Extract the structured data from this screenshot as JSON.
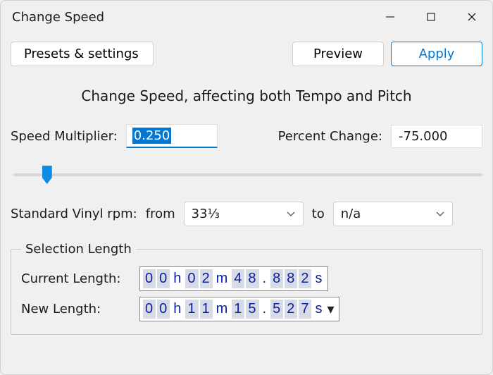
{
  "window": {
    "title": "Change Speed"
  },
  "buttons": {
    "presets": "Presets & settings",
    "preview": "Preview",
    "apply": "Apply"
  },
  "heading": "Change Speed, affecting both Tempo and Pitch",
  "speed": {
    "multiplier_label": "Speed Multiplier:",
    "multiplier_value": "0.250",
    "percent_label": "Percent Change:",
    "percent_value": "-75.000"
  },
  "slider": {
    "min": -100,
    "max": 300,
    "value": -75
  },
  "vinyl": {
    "label": "Standard Vinyl rpm:",
    "from_label": "from",
    "from_value": "33⅓",
    "to_label": "to",
    "to_value": "n/a"
  },
  "selection": {
    "legend": "Selection Length",
    "current_label": "Current Length:",
    "current_digits": [
      "0",
      "0",
      "h",
      "0",
      "2",
      "m",
      "4",
      "8",
      ".",
      "8",
      "8",
      "2",
      "s"
    ],
    "new_label": "New Length:",
    "new_digits": [
      "0",
      "0",
      "h",
      "1",
      "1",
      "m",
      "1",
      "5",
      ".",
      "5",
      "2",
      "7",
      "s"
    ]
  }
}
